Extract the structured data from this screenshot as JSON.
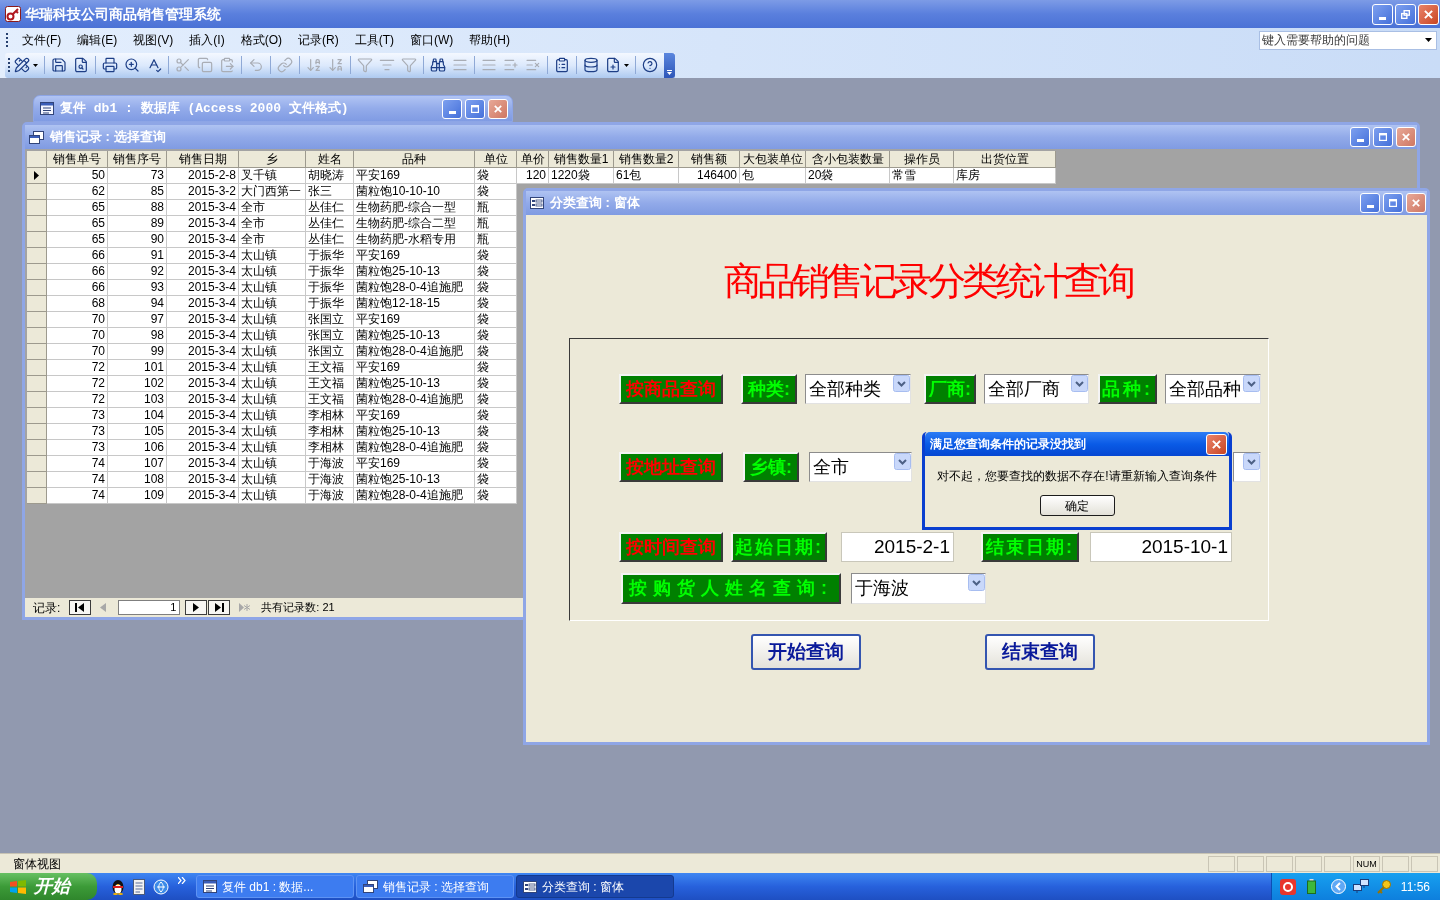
{
  "app": {
    "title": "华瑞科技公司商品销售管理系统"
  },
  "menu": [
    "文件(F)",
    "编辑(E)",
    "视图(V)",
    "插入(I)",
    "格式(O)",
    "记录(R)",
    "工具(T)",
    "窗口(W)",
    "帮助(H)"
  ],
  "help_box": {
    "placeholder": "键入需要帮助的问题"
  },
  "toolbar": [
    [
      {
        "disabled": false,
        "dropdown": true
      }
    ],
    [
      {
        "disabled": false
      },
      {
        "disabled": false
      }
    ],
    [
      {
        "disabled": false
      },
      {
        "disabled": false
      },
      {
        "disabled": false
      }
    ],
    [
      {
        "disabled": true
      },
      {
        "disabled": true
      },
      {
        "disabled": true
      }
    ],
    [
      {
        "disabled": true
      }
    ],
    [
      {
        "disabled": true
      }
    ],
    [
      {
        "disabled": true
      },
      {
        "disabled": true
      }
    ],
    [
      {
        "disabled": true
      },
      {
        "disabled": true
      },
      {
        "disabled": true
      }
    ],
    [
      {
        "disabled": false
      },
      {
        "disabled": true
      }
    ],
    [
      {
        "disabled": true
      },
      {
        "disabled": true
      },
      {
        "disabled": true
      }
    ],
    [
      {
        "disabled": false
      }
    ],
    [
      {
        "disabled": false
      },
      {
        "disabled": false,
        "dropdown": true
      }
    ],
    [
      {
        "disabled": false
      }
    ]
  ],
  "db_window": {
    "title": "复件 db1 : 数据库 (Access 2000 文件格式)"
  },
  "query_window": {
    "title": "销售记录 : 选择查询",
    "columns": [
      "销售单号",
      "销售序号",
      "销售日期",
      "乡",
      "姓名",
      "品种",
      "单位",
      "单价",
      "销售数量1",
      "销售数量2",
      "销售额",
      "大包装单位",
      "含小包装数量",
      "操作员",
      "出货位置"
    ],
    "rows": [
      {
        "current": true,
        "cells": [
          "50",
          "73",
          "2015-2-8",
          "叉千镇",
          "胡晓涛",
          "平安169",
          "袋",
          "120",
          "1220袋",
          "61包",
          "146400",
          "包",
          "20袋",
          "常雪",
          "库房"
        ]
      },
      {
        "current": false,
        "cells": [
          "62",
          "85",
          "2015-3-2",
          "大门西第一",
          "张三",
          "菌粒饱10-10-10",
          "袋"
        ]
      },
      {
        "current": false,
        "cells": [
          "65",
          "88",
          "2015-3-4",
          "全市",
          "丛佳仁",
          "生物药肥-综合一型",
          "瓶"
        ]
      },
      {
        "current": false,
        "cells": [
          "65",
          "89",
          "2015-3-4",
          "全市",
          "丛佳仁",
          "生物药肥-综合二型",
          "瓶"
        ]
      },
      {
        "current": false,
        "cells": [
          "65",
          "90",
          "2015-3-4",
          "全市",
          "丛佳仁",
          "生物药肥-水稻专用",
          "瓶"
        ]
      },
      {
        "current": false,
        "cells": [
          "66",
          "91",
          "2015-3-4",
          "太山镇",
          "于振华",
          "平安169",
          "袋"
        ]
      },
      {
        "current": false,
        "cells": [
          "66",
          "92",
          "2015-3-4",
          "太山镇",
          "于振华",
          "菌粒饱25-10-13",
          "袋"
        ]
      },
      {
        "current": false,
        "cells": [
          "66",
          "93",
          "2015-3-4",
          "太山镇",
          "于振华",
          "菌粒饱28-0-4追施肥",
          "袋"
        ]
      },
      {
        "current": false,
        "cells": [
          "68",
          "94",
          "2015-3-4",
          "太山镇",
          "于振华",
          "菌粒饱12-18-15",
          "袋"
        ]
      },
      {
        "current": false,
        "cells": [
          "70",
          "97",
          "2015-3-4",
          "太山镇",
          "张国立",
          "平安169",
          "袋"
        ]
      },
      {
        "current": false,
        "cells": [
          "70",
          "98",
          "2015-3-4",
          "太山镇",
          "张国立",
          "菌粒饱25-10-13",
          "袋"
        ]
      },
      {
        "current": false,
        "cells": [
          "70",
          "99",
          "2015-3-4",
          "太山镇",
          "张国立",
          "菌粒饱28-0-4追施肥",
          "袋"
        ]
      },
      {
        "current": false,
        "cells": [
          "72",
          "101",
          "2015-3-4",
          "太山镇",
          "王文福",
          "平安169",
          "袋"
        ]
      },
      {
        "current": false,
        "cells": [
          "72",
          "102",
          "2015-3-4",
          "太山镇",
          "王文福",
          "菌粒饱25-10-13",
          "袋"
        ]
      },
      {
        "current": false,
        "cells": [
          "72",
          "103",
          "2015-3-4",
          "太山镇",
          "王文福",
          "菌粒饱28-0-4追施肥",
          "袋"
        ]
      },
      {
        "current": false,
        "cells": [
          "73",
          "104",
          "2015-3-4",
          "太山镇",
          "李相林",
          "平安169",
          "袋"
        ]
      },
      {
        "current": false,
        "cells": [
          "73",
          "105",
          "2015-3-4",
          "太山镇",
          "李相林",
          "菌粒饱25-10-13",
          "袋"
        ]
      },
      {
        "current": false,
        "cells": [
          "73",
          "106",
          "2015-3-4",
          "太山镇",
          "李相林",
          "菌粒饱28-0-4追施肥",
          "袋"
        ]
      },
      {
        "current": false,
        "cells": [
          "74",
          "107",
          "2015-3-4",
          "太山镇",
          "于海波",
          "平安169",
          "袋"
        ]
      },
      {
        "current": false,
        "cells": [
          "74",
          "108",
          "2015-3-4",
          "太山镇",
          "于海波",
          "菌粒饱25-10-13",
          "袋"
        ]
      },
      {
        "current": false,
        "cells": [
          "74",
          "109",
          "2015-3-4",
          "太山镇",
          "于海波",
          "菌粒饱28-0-4追施肥",
          "袋"
        ]
      }
    ],
    "navigator": {
      "label": "记录:",
      "value": "1",
      "total": "共有记录数: 21",
      "buttons": [
        {
          "disabled": false
        },
        {
          "disabled": true
        },
        {
          "disabled": false
        },
        {
          "disabled": false
        },
        {
          "disabled": true
        }
      ]
    }
  },
  "form_window": {
    "title": "分类查询 : 窗体",
    "heading": "商品销售记录分类统计查询",
    "product_query": {
      "button": "按商品查询",
      "category_label": "种类:",
      "category": "全部种类",
      "maker_label": "厂商:",
      "maker": "全部厂商",
      "variety_label": "品种:",
      "variety": "全部品种"
    },
    "address_query": {
      "button": "按地址查询",
      "town_label": "乡镇:",
      "town": "全市"
    },
    "date_query": {
      "button": "按时间查询",
      "start_label": "起始日期:",
      "start": "2015-2-1",
      "end_label": "结束日期:",
      "end": "2015-10-1"
    },
    "buyer_query": {
      "label": "按购货人姓名查询:",
      "buyer": "于海波"
    },
    "buttons": [
      "开始查询",
      "结束查询"
    ]
  },
  "dialog": {
    "title": "满足您查询条件的记录没找到",
    "message": "对不起，您要查找的数据不存在!请重新输入查询条件",
    "button": "确定"
  },
  "status_bar": {
    "mode": "窗体视图",
    "indicator": "NUM"
  },
  "taskbar": {
    "start": "开始",
    "tasks": [
      {
        "label": "复件 db1 : 数据...",
        "selected": false
      },
      {
        "label": "销售记录 : 选择查询",
        "selected": false
      },
      {
        "label": "分类查询 : 窗体",
        "selected": true
      }
    ],
    "clock": "11:56"
  }
}
